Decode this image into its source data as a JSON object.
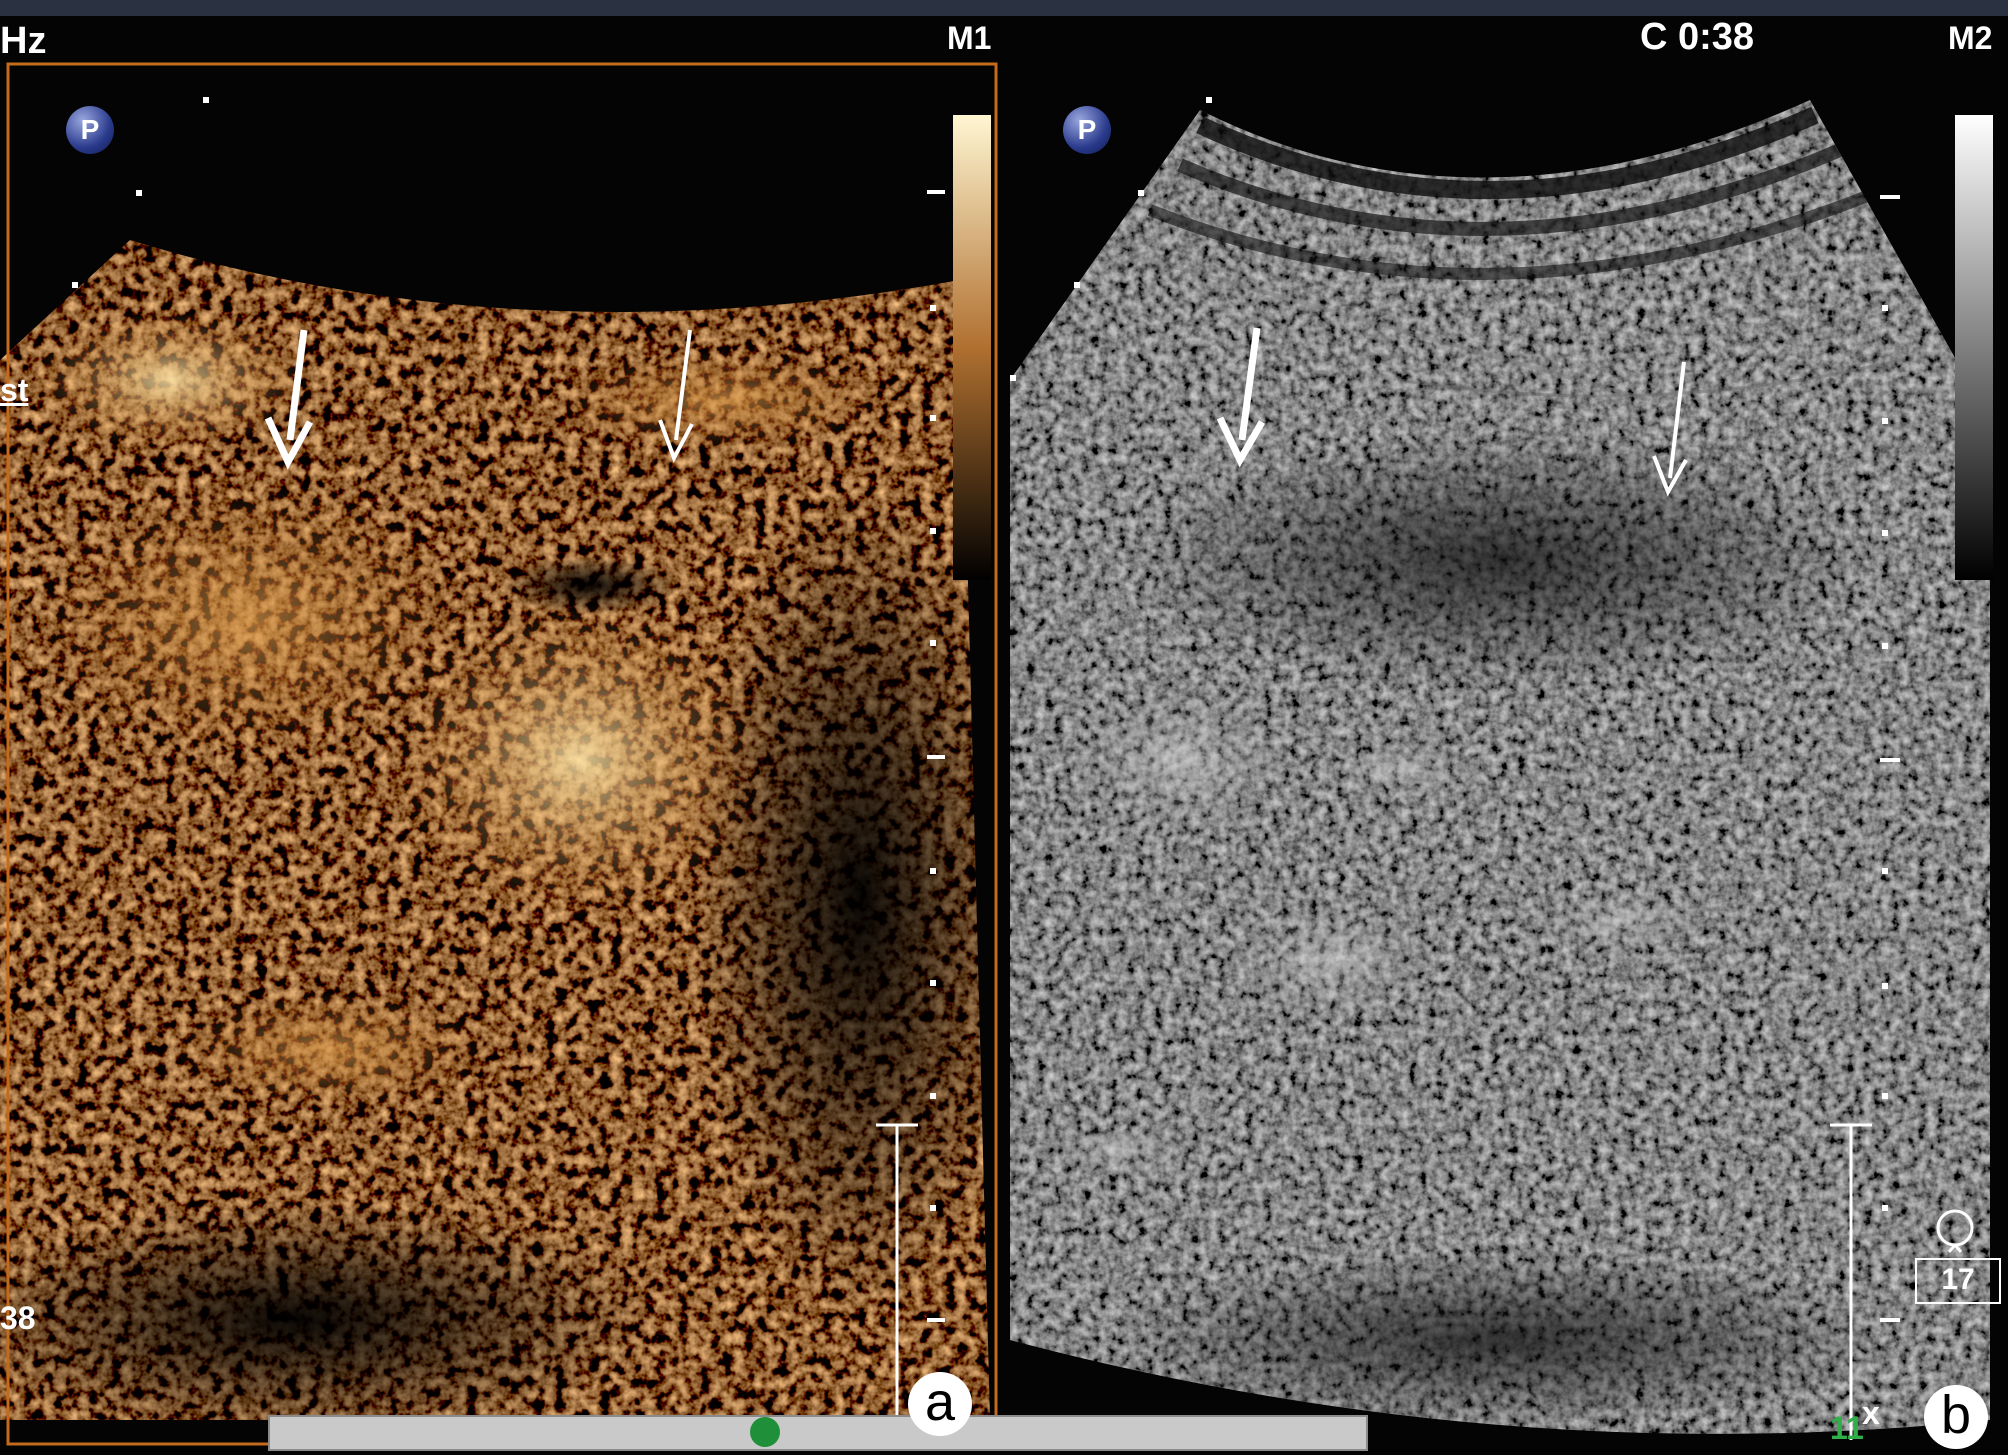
{
  "header": {
    "left_unit_text": "Hz",
    "clip_time": "C 0:38",
    "left_marker": "M1",
    "right_marker": "M2"
  },
  "left_panel": {
    "mode": "contrast-enhanced",
    "edge_label_top": "st",
    "edge_label_bottom": "38",
    "probe_badge": "P",
    "panel_label": "a",
    "colorbar": {
      "top_color": "#fff6d2",
      "mid_color": "#b07030",
      "bottom_color": "#000000"
    }
  },
  "right_panel": {
    "mode": "b-mode",
    "probe_badge": "P",
    "panel_label": "b",
    "frame_counter": "17",
    "depth_bottom_label": "11",
    "depth_x_label": "x",
    "colorbar": {
      "top_color": "#ffffff",
      "bottom_color": "#000000"
    }
  },
  "timeline": {
    "progress_fraction": 0.45,
    "track_color": "#c9c9c9",
    "dot_color": "#1f8f3a"
  },
  "annotations": {
    "arrow_color": "#ffffff",
    "left_arrow_count": 2,
    "right_arrow_count": 2
  }
}
